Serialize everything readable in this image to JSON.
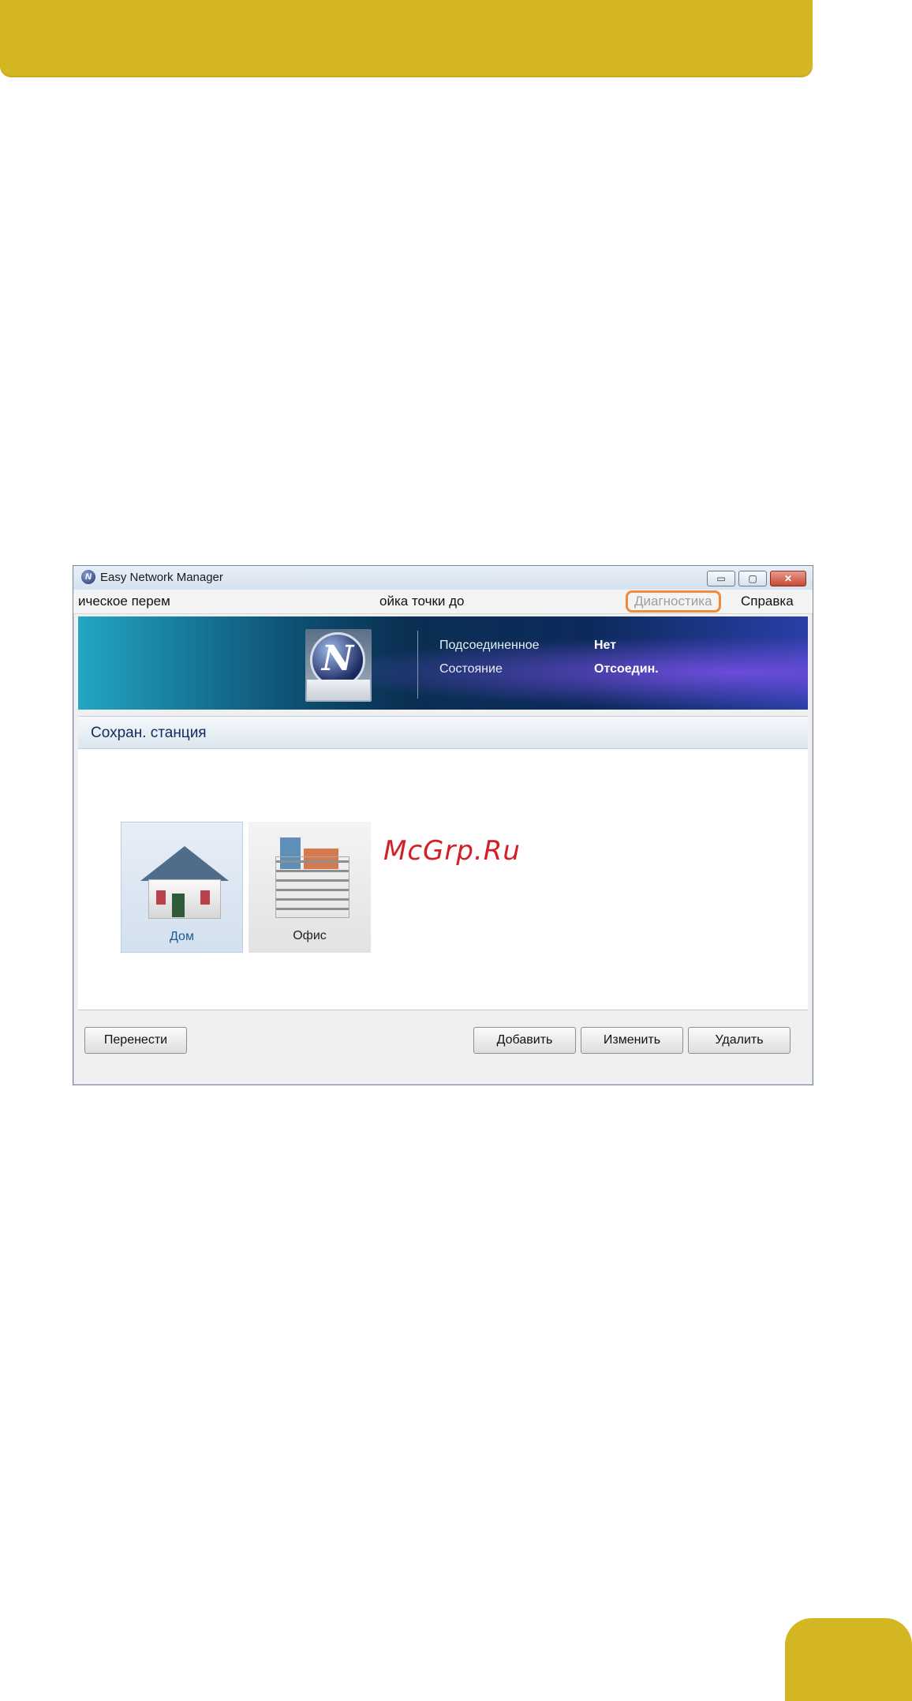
{
  "window": {
    "title": "Easy Network Manager",
    "controls": {
      "minimize": "▭",
      "maximize": "▢",
      "close": "✕"
    }
  },
  "menu": {
    "items": [
      "ическое перем",
      "ойка точки до",
      "Диагностика",
      "Справка"
    ]
  },
  "status": {
    "connected_label": "Подсоединенное",
    "connected_value": "Нет",
    "state_label": "Состояние",
    "state_value": "Отсоедин."
  },
  "logo_letter": "N",
  "section": {
    "title": "Сохран. станция"
  },
  "stations": [
    {
      "label": "Дом",
      "icon": "house-icon",
      "selected": true
    },
    {
      "label": "Офис",
      "icon": "office-building-icon",
      "selected": false
    }
  ],
  "buttons": {
    "move": "Перенести",
    "add": "Добавить",
    "edit": "Изменить",
    "delete": "Удалить"
  },
  "watermark": "McGrp.Ru",
  "colors": {
    "banner": "#d4b623",
    "highlight": "#f08a3c"
  }
}
